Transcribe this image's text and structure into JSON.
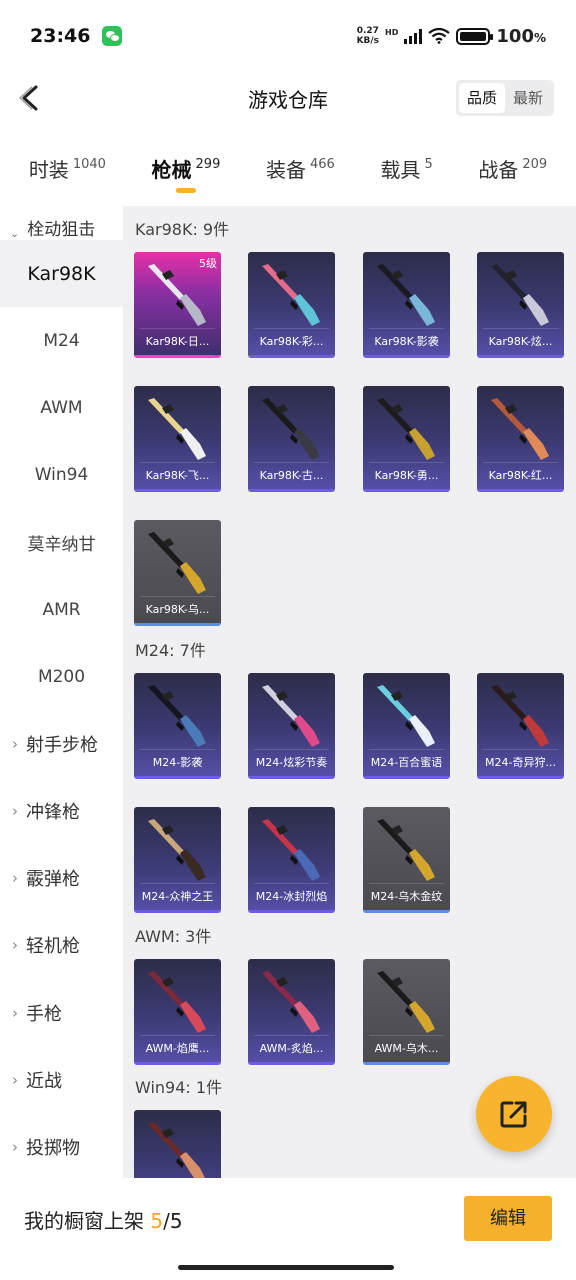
{
  "status_bar": {
    "time": "23:46",
    "net_speed": "0.27",
    "net_unit": "KB/s",
    "hd": "HD",
    "battery": "100",
    "battery_unit": "%"
  },
  "header": {
    "title": "游戏仓库",
    "sort_options": [
      "品质",
      "最新"
    ],
    "active_sort": "品质"
  },
  "tabs": [
    {
      "label": "时装",
      "count": "1040"
    },
    {
      "label": "枪械",
      "count": "299",
      "active": true
    },
    {
      "label": "装备",
      "count": "466"
    },
    {
      "label": "载具",
      "count": "5"
    },
    {
      "label": "战备",
      "count": "209"
    }
  ],
  "sidebar": {
    "group_label": "栓动狙击",
    "items": [
      "Kar98K",
      "M24",
      "AWM",
      "Win94",
      "莫辛纳甘",
      "AMR",
      "M200"
    ],
    "active_item": "Kar98K",
    "categories": [
      "射手步枪",
      "冲锋枪",
      "霰弹枪",
      "轻机枪",
      "手枪",
      "近战",
      "投掷物"
    ]
  },
  "sections": [
    {
      "title": "Kar98K: 9件",
      "items": [
        {
          "name": "Kar98K-日...",
          "rarity": "pink",
          "level": "5级",
          "colors": [
            "#e8e8f0",
            "#b6b8c8"
          ]
        },
        {
          "name": "Kar98K-彩...",
          "rarity": "purple",
          "colors": [
            "#e46a8a",
            "#5fc4d8"
          ]
        },
        {
          "name": "Kar98K-影袭",
          "rarity": "purple",
          "colors": [
            "#1a1a22",
            "#7ab6d8"
          ]
        },
        {
          "name": "Kar98K-炫...",
          "rarity": "purple",
          "colors": [
            "#222230",
            "#c8c8d8"
          ]
        },
        {
          "name": "Kar98K-飞...",
          "rarity": "purple",
          "colors": [
            "#e8d48a",
            "#f0f0f0"
          ]
        },
        {
          "name": "Kar98K-古...",
          "rarity": "purple",
          "colors": [
            "#1a1a1a",
            "#3a3a44"
          ]
        },
        {
          "name": "Kar98K-勇...",
          "rarity": "purple",
          "colors": [
            "#1c1c1c",
            "#c8a030"
          ]
        },
        {
          "name": "Kar98K-红...",
          "rarity": "purple",
          "colors": [
            "#b85a3a",
            "#e08a5a"
          ]
        },
        {
          "name": "Kar98K-乌...",
          "rarity": "gray",
          "colors": [
            "#1a1a1a",
            "#d4a72c"
          ]
        }
      ]
    },
    {
      "title": "M24: 7件",
      "items": [
        {
          "name": "M24-影袭",
          "rarity": "purple",
          "colors": [
            "#151520",
            "#4a7ab8"
          ]
        },
        {
          "name": "M24-炫彩节奏",
          "rarity": "purple",
          "colors": [
            "#d0d0dc",
            "#e04a8a"
          ]
        },
        {
          "name": "M24-百合蜜语",
          "rarity": "purple",
          "colors": [
            "#6ad0e0",
            "#e8f0f8"
          ]
        },
        {
          "name": "M24-奇异狩...",
          "rarity": "purple",
          "colors": [
            "#2a1a1a",
            "#c03a3a"
          ]
        },
        {
          "name": "M24-众神之王",
          "rarity": "purple",
          "colors": [
            "#c8a878",
            "#3a2a22"
          ]
        },
        {
          "name": "M24-冰封烈焰",
          "rarity": "purple",
          "colors": [
            "#c8344a",
            "#4a6ab8"
          ]
        },
        {
          "name": "M24-乌木金纹",
          "rarity": "gray",
          "colors": [
            "#1a1a1a",
            "#d4a72c"
          ]
        }
      ]
    },
    {
      "title": "AWM: 3件",
      "items": [
        {
          "name": "AWM-焰鹰...",
          "rarity": "purple",
          "colors": [
            "#7a2a3a",
            "#d84a5a"
          ]
        },
        {
          "name": "AWM-炙焰...",
          "rarity": "purple",
          "colors": [
            "#8a2a4a",
            "#e06080"
          ]
        },
        {
          "name": "AWM-乌木...",
          "rarity": "gray",
          "colors": [
            "#1a1a1a",
            "#d4a72c"
          ]
        }
      ]
    },
    {
      "title": "Win94: 1件",
      "items": [
        {
          "name": "Win94-...",
          "rarity": "purple",
          "colors": [
            "#6a2a2a",
            "#d8906a"
          ]
        }
      ]
    }
  ],
  "bottom": {
    "showcase_label": "我的橱窗上架 ",
    "showcase_current": "5",
    "showcase_total": "/5",
    "edit_label": "编辑"
  },
  "colors": {
    "accent": "#f6b02c",
    "rarity_pink": "#ff3ec1",
    "rarity_purple": "#6e5ce6",
    "rarity_gray_bar": "#5a8ee6"
  }
}
